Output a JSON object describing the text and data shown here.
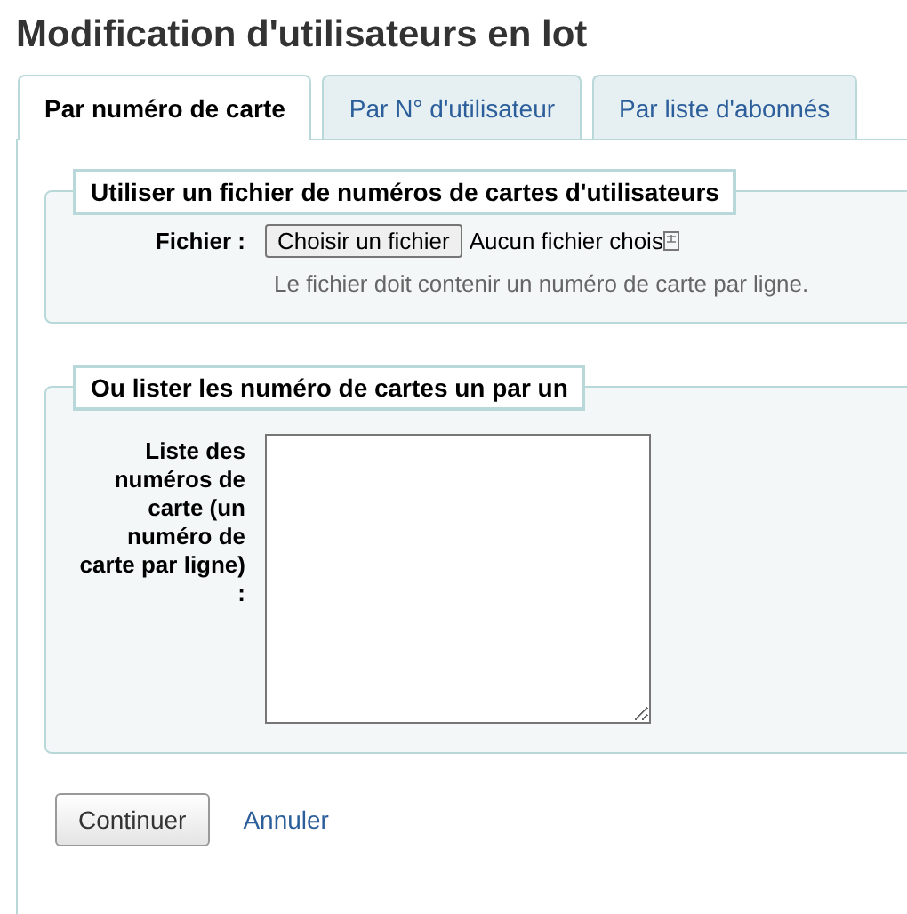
{
  "title": "Modification d'utilisateurs en lot",
  "tabs": [
    {
      "label": "Par numéro de carte",
      "selected": true
    },
    {
      "label": "Par N° d'utilisateur",
      "selected": false
    },
    {
      "label": "Par liste d'abonnés",
      "selected": false
    }
  ],
  "file_section": {
    "legend": "Utiliser un fichier de numéros de cartes d'utilisateurs",
    "label": "Fichier :",
    "button": "Choisir un fichier",
    "status": "Aucun fichier chois",
    "hint": "Le fichier doit contenir un numéro de carte par ligne."
  },
  "list_section": {
    "legend": "Ou lister les numéro de cartes un par un",
    "label": "Liste des numéros de carte (un numéro de carte par ligne) :"
  },
  "actions": {
    "submit": "Continuer",
    "cancel": "Annuler"
  }
}
